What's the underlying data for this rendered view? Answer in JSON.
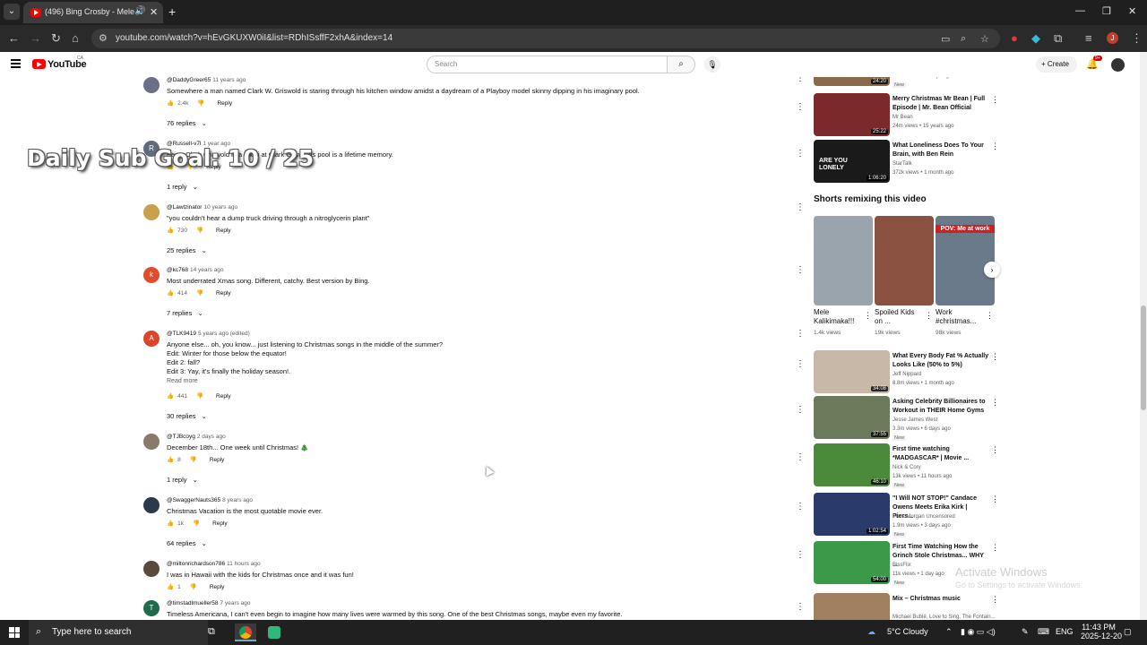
{
  "browser": {
    "tab_title": "(496) Bing Crosby - Mele K",
    "url": "youtube.com/watch?v=hEvGKUXW0iI&list=RDhISsffF2xhA&index=14"
  },
  "header": {
    "logo_text": "YouTube",
    "region": "CA",
    "search_placeholder": "Search",
    "create_label": "Create",
    "notif_badge": "9+",
    "profile_initial": "J"
  },
  "overlay_text": "Daily Sub Goal: 10 / 25",
  "comments": [
    {
      "handle": "@DaddyGreer65",
      "time": "11 years ago",
      "avatar_color": "#6b6f8a",
      "initial": "",
      "lines": [
        "Somewhere a man named Clark W. Griswold is staring through his kitchen window amidst a daydream of a Playboy model skinny dipping in his imaginary pool."
      ],
      "likes": "2.4k",
      "reply_label": "Reply",
      "replies": "76 replies"
    },
    {
      "handle": "@Russell-v7l",
      "time": "1 year ago",
      "avatar_color": "#5f6b7a",
      "initial": "R",
      "lines": [
        "Being Clark Griswold in a bikini at Clark Griswalds pool is a lifetime memory."
      ],
      "likes": "",
      "reply_label": "Reply",
      "replies": "1 reply"
    },
    {
      "handle": "@Lawlzinator",
      "time": "10 years ago",
      "avatar_color": "#c8a24a",
      "initial": "",
      "lines": [
        "\"you couldn't hear a dump truck driving through a nitroglycerin plant\""
      ],
      "likes": "730",
      "reply_label": "Reply",
      "replies": "25 replies"
    },
    {
      "handle": "@kc768",
      "time": "14 years ago",
      "avatar_color": "#e04c2c",
      "initial": "k",
      "lines": [
        "Most underrated Xmas song.  Different, catchy.  Best version by Bing."
      ],
      "likes": "414",
      "reply_label": "Reply",
      "replies": "7 replies"
    },
    {
      "handle": "@TLK9419",
      "time": "5 years ago (edited)",
      "avatar_color": "#d9462c",
      "initial": "A",
      "lines": [
        "Anyone else... oh, you know... just listening to Christmas songs in the middle of the summer?",
        "Edit: Winter for those below the equator!",
        "Edit 2: fall?",
        "Edit 3: Yay, it's finally the holiday season!."
      ],
      "read_more": "Read more",
      "likes": "441",
      "reply_label": "Reply",
      "replies": "30 replies"
    },
    {
      "handle": "@TJBcoyg",
      "time": "2 days ago",
      "avatar_color": "#8a7a6a",
      "initial": "",
      "lines": [
        "December 18th... One week until Christmas! 🎄"
      ],
      "likes": "8",
      "reply_label": "Reply",
      "replies": "1 reply"
    },
    {
      "handle": "@SwaggerNauts365",
      "time": "8 years ago",
      "avatar_color": "#2a3a4a",
      "initial": "",
      "lines": [
        "Christmas Vacation is the most quotable movie ever."
      ],
      "likes": "1k",
      "reply_label": "Reply",
      "replies": "64 replies"
    },
    {
      "handle": "@miltonrichardson786",
      "time": "11 hours ago",
      "avatar_color": "#5a4a3a",
      "initial": "",
      "lines": [
        "I was in Hawaii with the kids for Christmas once and it was fun!"
      ],
      "likes": "1",
      "reply_label": "Reply",
      "replies": ""
    },
    {
      "handle": "@timstadlmueller58",
      "time": "7 years ago",
      "avatar_color": "#1f6b4a",
      "initial": "T",
      "lines": [
        "Timeless Americana, I can't even begin to imagine how many lives were warmed by this song. One of the best Christmas songs, maybe even my favorite."
      ],
      "likes": "",
      "reply_label": "Reply",
      "replies": ""
    }
  ],
  "sidebar": {
    "partial_top": {
      "stats": "41.6k views • 2 days ago",
      "new_badge": "New",
      "duration": "24:20"
    },
    "videos_top": [
      {
        "title": "Merry Christmas Mr Bean | Full Episode | Mr. Bean Official",
        "channel": "Mr Bean",
        "stats": "24m views • 15 years ago",
        "duration": "25:22",
        "thumb": "#7a2a2a"
      },
      {
        "title": "What Loneliness Does To Your Brain, with Ben Rein",
        "channel": "StarTalk",
        "stats": "372k views • 1 month ago",
        "duration": "1:06:20",
        "thumb": "#1a1a1a",
        "thumb_text": "ARE YOU LONELY"
      }
    ],
    "shorts_heading": "Shorts remixing this video",
    "shorts": [
      {
        "title": "Mele Kalikimaka!!!",
        "views": "1.4k views",
        "thumb": "#9aa4ad"
      },
      {
        "title": "Spoiled Kids on ...",
        "views": "19k views",
        "thumb": "#8a5040"
      },
      {
        "title": "Work #christmas...",
        "views": "98k views",
        "thumb": "#6a7a8a",
        "overlay": "POV: Me at work"
      }
    ],
    "videos_bottom": [
      {
        "title": "What Every Body Fat % Actually Looks Like (50% to 5%)",
        "channel": "Jeff Nippard",
        "stats": "8.8m views • 1 month ago",
        "duration": "34:08",
        "thumb": "#c8b8a8",
        "new": ""
      },
      {
        "title": "Asking Celebrity Billionaires to Workout in THEIR Home Gyms",
        "channel": "Jesse James West",
        "stats": "3.3m views • 6 days ago",
        "duration": "37:55",
        "thumb": "#6a7a5a",
        "new": "New"
      },
      {
        "title": "First time watching *MADGASCAR* | Movie ...",
        "channel": "Nick & Cory",
        "stats": "13k views • 11 hours ago",
        "duration": "46:10",
        "thumb": "#4a8a3a",
        "new": "New"
      },
      {
        "title": "\"I Will NOT STOP!\" Candace Owens Meets Erika Kirk | Piers...",
        "channel": "Piers Morgan Uncensored",
        "stats": "1.9m views • 3 days ago",
        "duration": "1:02:54",
        "thumb": "#2a3a6a",
        "new": "New"
      },
      {
        "title": "First Time Watching How the Grinch Stole Christmas... WHY ...",
        "channel": "BissFlix",
        "stats": "11k views • 1 day ago",
        "duration": "54:00",
        "thumb": "#3a9a4a",
        "new": "New"
      },
      {
        "title": "Mix – Christmas music",
        "channel": "Michael Bublé, Love to Sing, The Fontain...",
        "stats": "",
        "duration": "",
        "thumb": "#a08060",
        "new": ""
      }
    ]
  },
  "watermark": {
    "line1": "Activate Windows",
    "line2": "Go to Settings to activate Windows."
  },
  "taskbar": {
    "search_text": "Type here to search",
    "weather": "5°C  Cloudy",
    "lang": "ENG",
    "time": "11:43 PM",
    "date": "2025-12-20"
  }
}
